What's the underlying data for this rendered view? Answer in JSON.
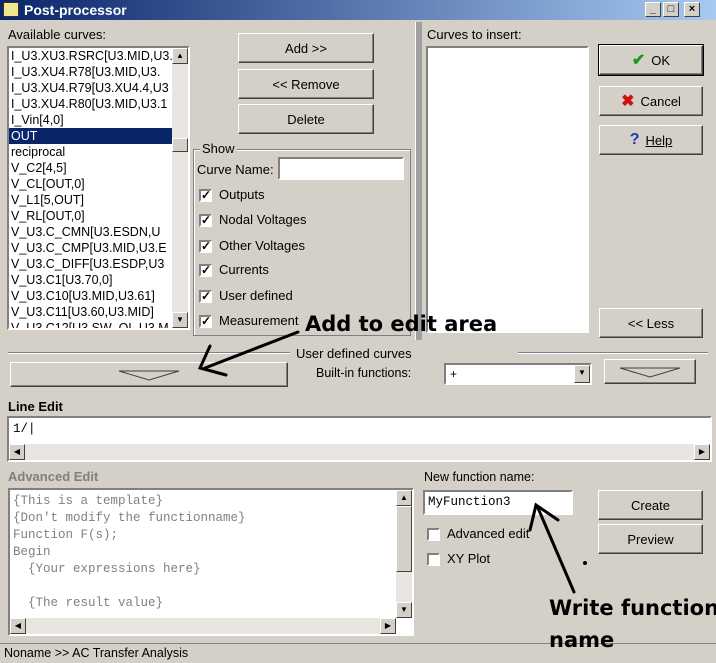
{
  "window": {
    "title": "Post-processor",
    "controls": [
      "_",
      "□",
      "×"
    ]
  },
  "available_curves": {
    "label": "Available curves:",
    "items": [
      "I_U3.XU3.RSRC[U3.MID,U3.",
      "I_U3.XU4.R78[U3.MID,U3.",
      "I_U3.XU4.R79[U3.XU4.4,U3",
      "I_U3.XU4.R80[U3.MID,U3.1",
      "I_Vin[4,0]",
      "OUT",
      "reciprocal",
      "V_C2[4,5]",
      "V_CL[OUT,0]",
      "V_L1[5,OUT]",
      "V_RL[OUT,0]",
      "V_U3.C_CMN[U3.ESDN,U",
      "V_U3.C_CMP[U3.MID,U3.E",
      "V_U3.C_DIFF[U3.ESDP,U3",
      "V_U3.C1[U3.70,0]",
      "V_U3.C10[U3.MID,U3.61]",
      "V_U3.C11[U3.60,U3.MID]",
      "V_U3.C12[U3.SW_OL,U3.M"
    ],
    "selected": "OUT"
  },
  "buttons": {
    "add": "Add >>",
    "remove": "<< Remove",
    "delete": "Delete",
    "ok": "OK",
    "cancel": "Cancel",
    "help": "Help",
    "less": "<< Less",
    "create": "Create",
    "preview": "Preview"
  },
  "show": {
    "title": "Show",
    "curve_name_label": "Curve Name:",
    "curve_name_value": "",
    "options": [
      {
        "label": "Outputs",
        "checked": true
      },
      {
        "label": "Nodal Voltages",
        "checked": true
      },
      {
        "label": "Other Voltages",
        "checked": true
      },
      {
        "label": "Currents",
        "checked": true
      },
      {
        "label": "User defined",
        "checked": true
      },
      {
        "label": "Measurement",
        "checked": true
      }
    ]
  },
  "curves_to_insert": {
    "label": "Curves to insert:"
  },
  "user_defined": {
    "title": "User defined curves",
    "builtin_label": "Built-in functions:",
    "builtin_value": "+"
  },
  "line_edit": {
    "label": "Line Edit",
    "value": "1/"
  },
  "advanced_edit": {
    "label": "Advanced Edit",
    "lines": [
      "{This is a template}",
      "{Don't modify the functionname}",
      "Function F(s);",
      "Begin",
      "  {Your expressions here}",
      "",
      "  {The result value}"
    ]
  },
  "new_function": {
    "label": "New function name:",
    "value": "MyFunction3",
    "advanced_edit_label": "Advanced edit",
    "advanced_edit_checked": false,
    "xy_plot_label": "XY Plot",
    "xy_plot_checked": false
  },
  "status_bar": {
    "text": "Noname >> AC Transfer Analysis"
  },
  "annotations": {
    "add_to_edit_area": "Add to edit area",
    "write_function_line1": "Write function",
    "write_function_line2": "name"
  },
  "colors": {
    "title_start": "#0a246a",
    "title_end": "#a6caf0",
    "selection": "#0a246a",
    "ok_icon": "#1a9a1a",
    "cancel_icon": "#cc1010",
    "help_icon": "#1a3fb0"
  },
  "icons": {
    "ok": "check-icon",
    "cancel": "x-icon",
    "help": "question-icon"
  }
}
